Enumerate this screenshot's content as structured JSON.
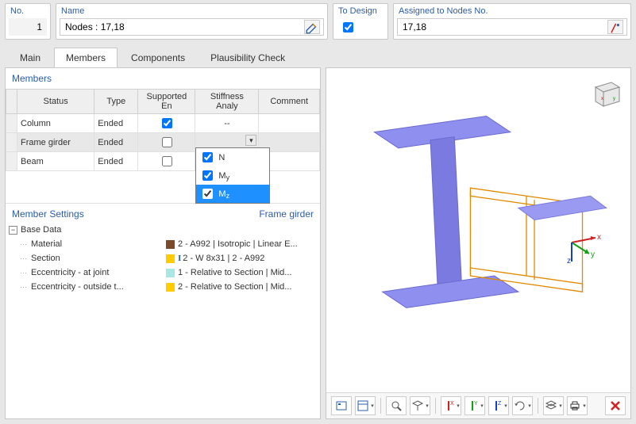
{
  "fields": {
    "no_label": "No.",
    "no_value": "1",
    "name_label": "Name",
    "name_value": "Nodes : 17,18",
    "todesign_label": "To Design",
    "todesign_checked": true,
    "assigned_label": "Assigned to Nodes No.",
    "assigned_value": "17,18"
  },
  "tabs": {
    "items": [
      "Main",
      "Members",
      "Components",
      "Plausibility Check"
    ],
    "active_index": 1
  },
  "members_panel": {
    "title": "Members",
    "columns": [
      "Status",
      "Type",
      "Supported En",
      "Stiffness Analy",
      "Comment"
    ],
    "rows": [
      {
        "status": "Column",
        "type": "Ended",
        "supported": true,
        "stiffness": "--",
        "comment": "",
        "selected": false
      },
      {
        "status": "Frame girder",
        "type": "Ended",
        "supported": false,
        "stiffness": "",
        "comment": "",
        "selected": true
      },
      {
        "status": "Beam",
        "type": "Ended",
        "supported": false,
        "stiffness": "",
        "comment": "",
        "selected": false
      }
    ],
    "stiffness_dropdown": {
      "options": [
        {
          "key": "N",
          "label_main": "N",
          "label_sub": "",
          "checked": true,
          "highlight": false
        },
        {
          "key": "My",
          "label_main": "M",
          "label_sub": "y",
          "checked": true,
          "highlight": false
        },
        {
          "key": "Mz",
          "label_main": "M",
          "label_sub": "z",
          "checked": true,
          "highlight": true
        }
      ]
    }
  },
  "member_settings": {
    "title": "Member Settings",
    "context": "Frame girder",
    "root": "Base Data",
    "items": [
      {
        "key": "Material",
        "swatch": "#7a4a2a",
        "value": "2 - A992 | Isotropic | Linear E..."
      },
      {
        "key": "Section",
        "swatch": "#ffcc00",
        "section_icon": true,
        "value": "2 - W 8x31 | 2 - A992"
      },
      {
        "key": "Eccentricity - at joint",
        "swatch": "#a9e6e6",
        "value": "1 - Relative to Section | Mid..."
      },
      {
        "key": "Eccentricity - outside t...",
        "swatch": "#ffcc00",
        "value": "2 - Relative to Section | Mid..."
      }
    ]
  },
  "toolbar": {
    "names": [
      "tool-view-settings",
      "tool-display-options",
      "tool-grid",
      "tool-zoom-extents",
      "tool-isometric",
      "tool-axis-x",
      "tool-axis-y",
      "tool-axis-z",
      "tool-rotate",
      "tool-section",
      "tool-layers",
      "tool-print",
      "tool-reset"
    ]
  }
}
